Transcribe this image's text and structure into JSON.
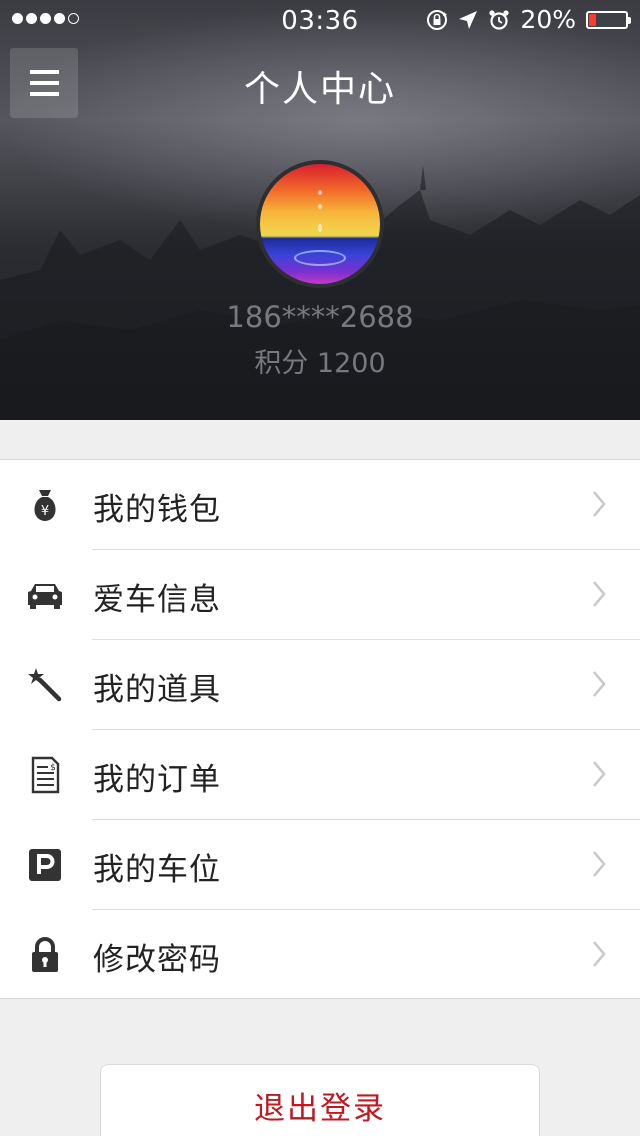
{
  "status_bar": {
    "time": "03:36",
    "battery_percent": "20%",
    "battery_level": 0.2,
    "signal_bars": 4,
    "signal_max": 5,
    "icons": [
      "orientation-lock-icon",
      "location-arrow-icon",
      "alarm-icon",
      "battery-icon"
    ]
  },
  "header": {
    "title": "个人中心",
    "menu_icon": "hamburger-menu-icon"
  },
  "profile": {
    "phone": "186****2688",
    "points": "积分 1200"
  },
  "menu": {
    "items": [
      {
        "label": "我的钱包",
        "icon": "money-bag-icon"
      },
      {
        "label": "爱车信息",
        "icon": "car-icon"
      },
      {
        "label": "我的道具",
        "icon": "magic-wand-icon"
      },
      {
        "label": "我的订单",
        "icon": "receipt-icon"
      },
      {
        "label": "我的车位",
        "icon": "parking-icon"
      },
      {
        "label": "修改密码",
        "icon": "lock-icon"
      }
    ]
  },
  "logout": {
    "label": "退出登录"
  },
  "colors": {
    "accent_red": "#c0191f",
    "battery_red": "#ff3b30",
    "header_dark": "#2b2c31",
    "page_background": "#efeff0"
  }
}
